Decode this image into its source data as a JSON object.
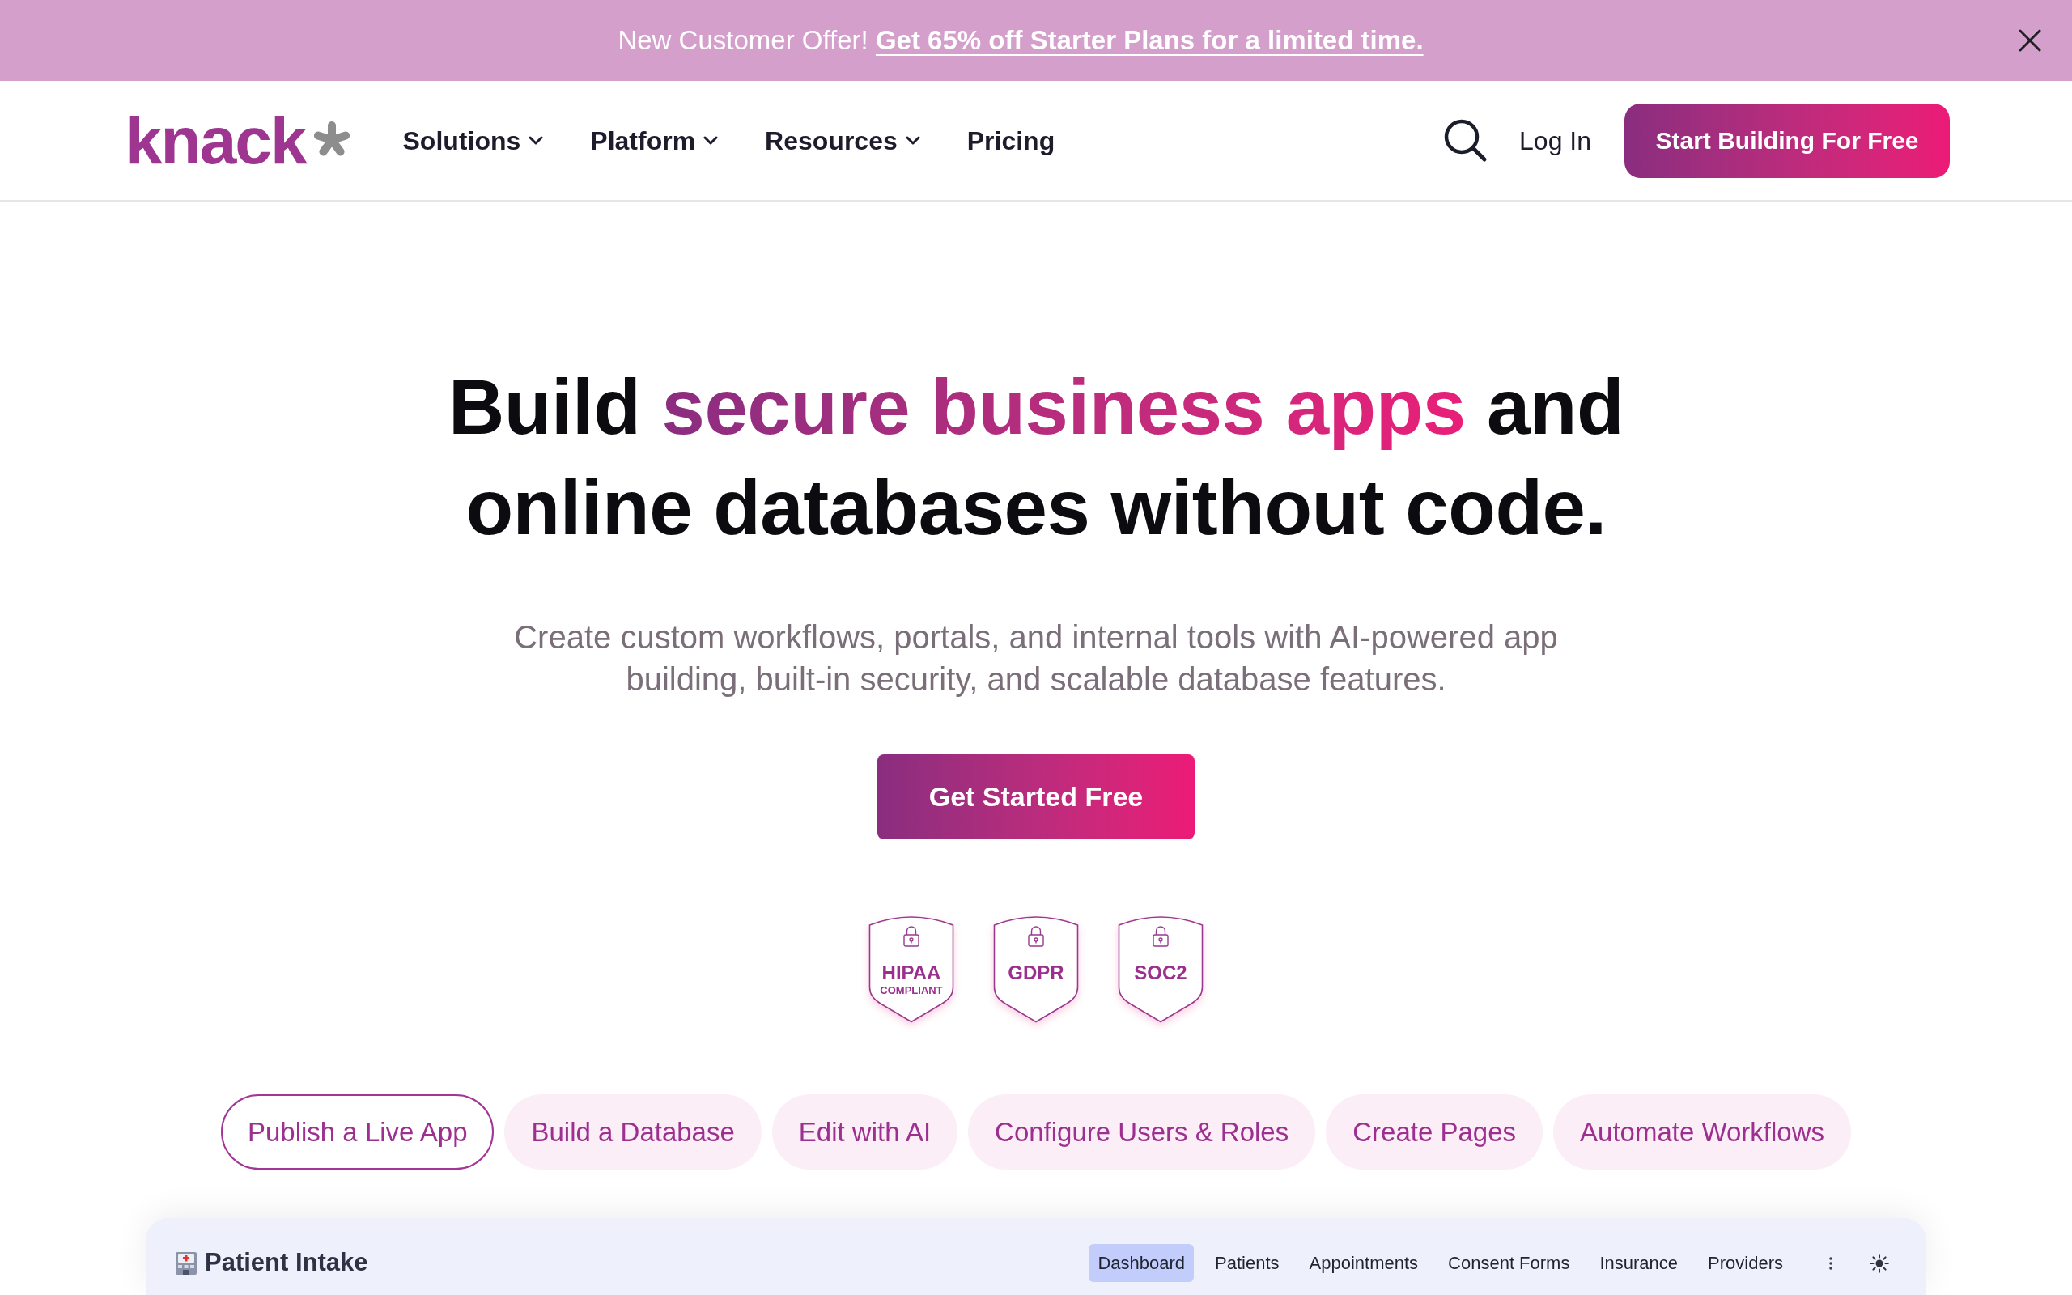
{
  "announcement": {
    "text": "New Customer Offer!",
    "link": "Get 65% off Starter Plans for a limited time."
  },
  "nav": {
    "logo": "knack",
    "items": [
      {
        "label": "Solutions",
        "has_dropdown": true
      },
      {
        "label": "Platform",
        "has_dropdown": true
      },
      {
        "label": "Resources",
        "has_dropdown": true
      },
      {
        "label": "Pricing",
        "has_dropdown": false
      }
    ],
    "login": "Log In",
    "cta": "Start Building For Free"
  },
  "hero": {
    "heading": {
      "lead": "Build ",
      "highlight": "secure business apps",
      "tail": " and online databases without code."
    },
    "subheading": "Create custom workflows, portals, and internal tools with AI-powered app building, built-in security, and scalable database features.",
    "cta": "Get Started Free",
    "badges": [
      {
        "title": "HIPAA",
        "subtitle": "COMPLIANT"
      },
      {
        "title": "GDPR"
      },
      {
        "title": "SOC2"
      }
    ]
  },
  "feature_tabs": [
    {
      "label": "Publish a Live App",
      "selected": true
    },
    {
      "label": "Build a Database",
      "selected": false
    },
    {
      "label": "Edit with AI",
      "selected": false
    },
    {
      "label": "Configure Users & Roles",
      "selected": false
    },
    {
      "label": "Create Pages",
      "selected": false
    },
    {
      "label": "Automate Workflows",
      "selected": false
    }
  ],
  "app_preview": {
    "title": "Patient Intake",
    "tabs": [
      {
        "label": "Dashboard",
        "selected": true
      },
      {
        "label": "Patients",
        "selected": false
      },
      {
        "label": "Appointments",
        "selected": false
      },
      {
        "label": "Consent Forms",
        "selected": false
      },
      {
        "label": "Insurance",
        "selected": false
      },
      {
        "label": "Providers",
        "selected": false
      }
    ]
  }
}
